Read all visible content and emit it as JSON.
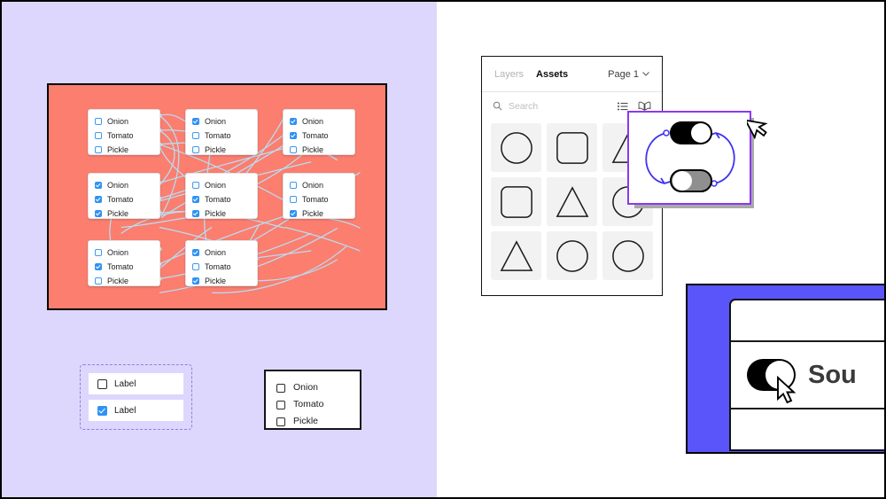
{
  "canvas": {
    "left_pane_color": "#ddd7fd",
    "right_pane_color": "#ffffff"
  },
  "graph_panel": {
    "background_color": "#fb7e6f",
    "connector_color": "#b9dcf1",
    "options": [
      "Onion",
      "Tomato",
      "Pickle"
    ],
    "nodes": [
      {
        "id": "node-1",
        "checked": [
          false,
          false,
          false
        ]
      },
      {
        "id": "node-2",
        "checked": [
          true,
          false,
          false
        ]
      },
      {
        "id": "node-3",
        "checked": [
          true,
          true,
          false
        ]
      },
      {
        "id": "node-4",
        "checked": [
          true,
          true,
          true
        ]
      },
      {
        "id": "node-5",
        "checked": [
          false,
          true,
          true
        ]
      },
      {
        "id": "node-6",
        "checked": [
          false,
          false,
          true
        ]
      },
      {
        "id": "node-7",
        "checked": [
          false,
          true,
          false
        ]
      },
      {
        "id": "node-8",
        "checked": [
          true,
          false,
          true
        ]
      }
    ]
  },
  "label_spec": {
    "rows": [
      {
        "label": "Label",
        "checked": false
      },
      {
        "label": "Label",
        "checked": true
      }
    ]
  },
  "spec_card": {
    "rows": [
      {
        "label": "Onion",
        "checked": false
      },
      {
        "label": "Tomato",
        "checked": false
      },
      {
        "label": "Pickle",
        "checked": false
      }
    ]
  },
  "assets_panel": {
    "tabs": [
      {
        "label": "Layers",
        "active": false
      },
      {
        "label": "Assets",
        "active": true
      }
    ],
    "page_selector": "Page 1",
    "page_chevron": "chevron-down-icon",
    "search_placeholder": "Search",
    "search_icon": "search-icon",
    "view_list_icon": "list-view-icon",
    "library_icon": "book-library-icon",
    "assets": [
      "circle",
      "rounded-square",
      "triangle",
      "rounded-square",
      "triangle",
      "circle",
      "triangle",
      "circle",
      "circle"
    ]
  },
  "toggle_frame": {
    "border_color": "#8d38f0",
    "arrow_color": "#3f32ef",
    "toggles": [
      {
        "name": "toggle-on",
        "state": "on",
        "track_color": "#000000"
      },
      {
        "name": "toggle-off",
        "state": "off",
        "track_color": "#8f8f8f"
      }
    ],
    "cursor": "arrow-cursor"
  },
  "blue_mock": {
    "panel_color": "#5a55fa",
    "toggle_state": "on",
    "setting_label": "Sou",
    "cursor": "arrow-cursor-white"
  }
}
